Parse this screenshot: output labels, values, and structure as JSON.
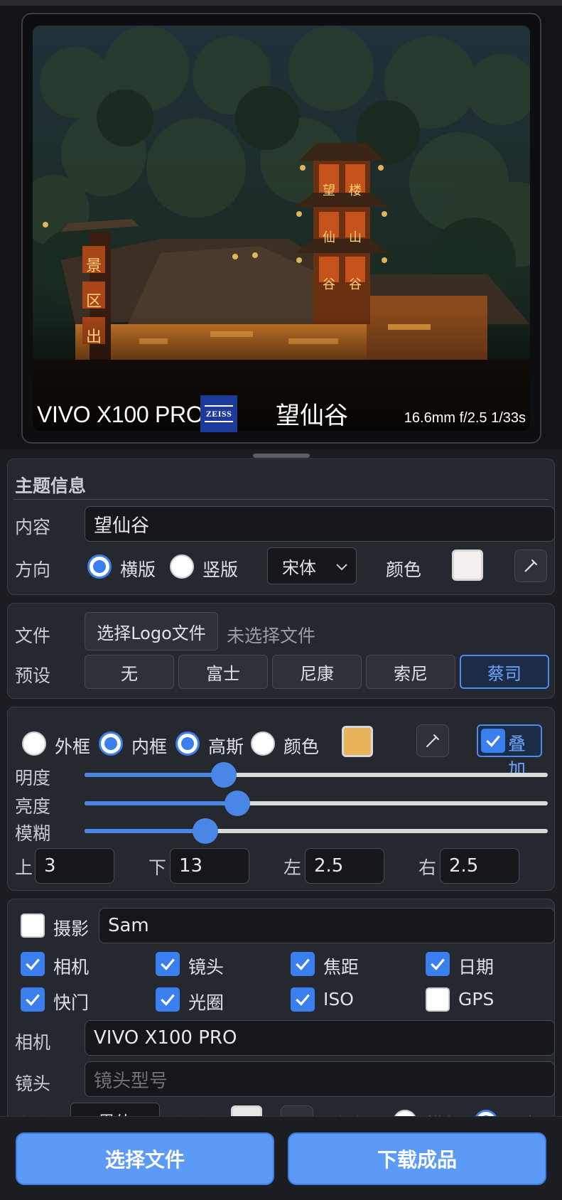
{
  "preview": {
    "camera": "VIVO X100 PRO",
    "brand_logo_text": "ZEISS",
    "title": "望仙谷",
    "params": "16.6mm f/2.5 1/33s",
    "sign_left": [
      "景",
      "区",
      "出"
    ],
    "sign_tower": [
      "望",
      "仙",
      "谷",
      "楼",
      "山",
      "谷"
    ]
  },
  "theme": {
    "heading": "主题信息",
    "content_label": "内容",
    "content_value": "望仙谷",
    "direction_label": "方向",
    "orient_horizontal": "横版",
    "orient_vertical": "竖版",
    "font_value": "宋体",
    "color_label": "颜色",
    "color_value": "#f5f0f0"
  },
  "file": {
    "file_label": "文件",
    "choose_logo": "选择Logo文件",
    "no_file": "未选择文件",
    "preset_label": "预设",
    "presets": [
      "无",
      "富士",
      "尼康",
      "索尼",
      "蔡司"
    ],
    "active_preset": "蔡司"
  },
  "frame": {
    "outer": "外框",
    "inner": "内框",
    "gauss": "高斯",
    "color": "颜色",
    "swatch": "#e8b55c",
    "overlay": "叠加",
    "brightness_label": "明度",
    "luminance_label": "亮度",
    "blur_label": "模糊",
    "brightness_value": 0.3,
    "luminance_value": 0.33,
    "blur_value": 0.26,
    "top_label": "上",
    "top_value": "3",
    "bottom_label": "下",
    "bottom_value": "13",
    "left_label": "左",
    "left_value": "2.5",
    "right_label": "右",
    "right_value": "2.5"
  },
  "exif": {
    "photographer_label": "摄影",
    "photographer_value": "Sam",
    "checks": [
      {
        "label": "相机",
        "checked": true
      },
      {
        "label": "镜头",
        "checked": true
      },
      {
        "label": "焦距",
        "checked": true
      },
      {
        "label": "日期",
        "checked": true
      },
      {
        "label": "快门",
        "checked": true
      },
      {
        "label": "光圈",
        "checked": true
      },
      {
        "label": "ISO",
        "checked": true
      },
      {
        "label": "GPS",
        "checked": false
      }
    ],
    "camera_label": "相机",
    "camera_value": "VIVO X100 PRO",
    "lens_label": "镜头",
    "lens_placeholder": "镜头型号",
    "font_label": "字体",
    "font_value": "黑体",
    "color_label": "颜色",
    "align_label": "方向",
    "orient_horizontal": "横版",
    "orient_vertical": "竖版"
  },
  "actions": {
    "select_file": "选择文件",
    "download": "下载成品"
  }
}
